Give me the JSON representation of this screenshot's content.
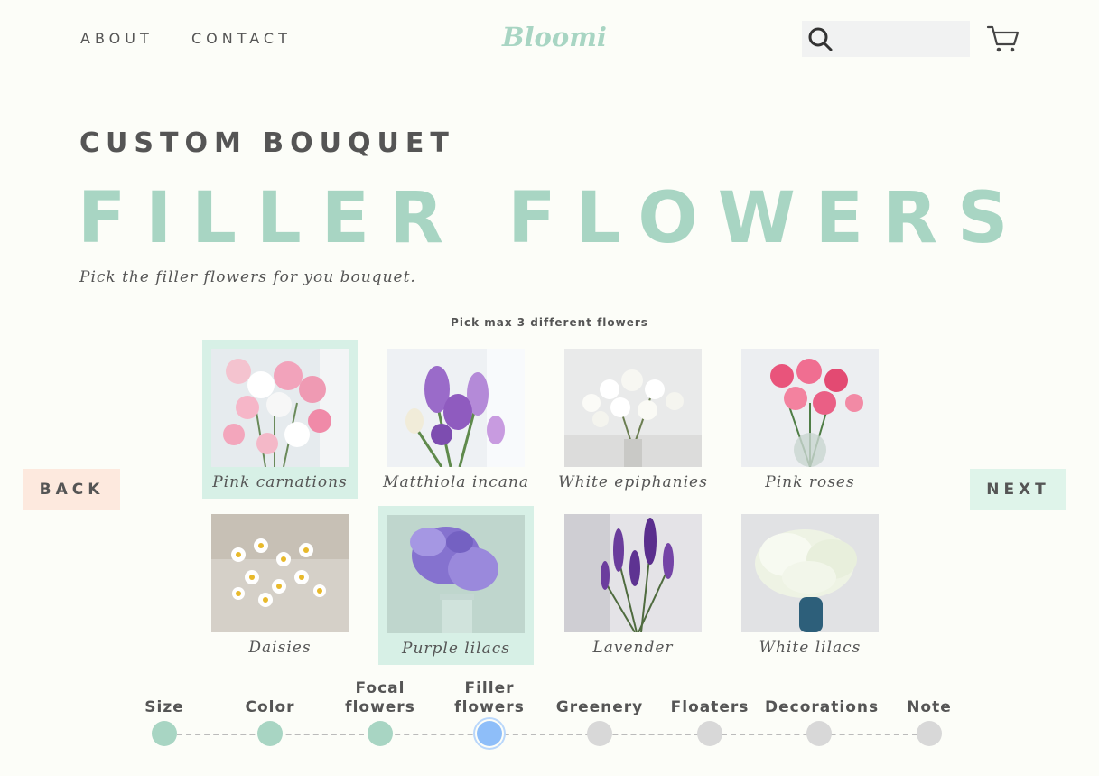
{
  "header": {
    "nav": [
      "ABOUT",
      "CONTACT"
    ],
    "logo": "Bloomi",
    "search_placeholder": ""
  },
  "page": {
    "subtitle": "CUSTOM BOUQUET",
    "title": "FILLER FLOWERS",
    "intro": "Pick the filler flowers for you bouquet.",
    "hint": "Pick max 3 different flowers"
  },
  "flowers": [
    {
      "name": "Pink carnations",
      "selected": true
    },
    {
      "name": "Matthiola incana",
      "selected": false
    },
    {
      "name": "White epiphanies",
      "selected": false
    },
    {
      "name": "Pink roses",
      "selected": false
    },
    {
      "name": "Daisies",
      "selected": false
    },
    {
      "name": "Purple lilacs",
      "selected": true
    },
    {
      "name": "Lavender",
      "selected": false
    },
    {
      "name": "White lilacs",
      "selected": false
    }
  ],
  "buttons": {
    "back": "BACK",
    "next": "NEXT"
  },
  "steps": [
    {
      "label": "Size",
      "state": "done"
    },
    {
      "label": "Color",
      "state": "done"
    },
    {
      "label": "Focal flowers",
      "state": "done"
    },
    {
      "label": "Filler flowers",
      "state": "current"
    },
    {
      "label": "Greenery",
      "state": "todo"
    },
    {
      "label": "Floaters",
      "state": "todo"
    },
    {
      "label": "Decorations",
      "state": "todo"
    },
    {
      "label": "Note",
      "state": "todo"
    }
  ],
  "colors": {
    "accent": "#a8d5c3",
    "selected_bg": "#d7f0e6",
    "back_bg": "#fde9de",
    "next_bg": "#dff4ea",
    "current_step": "#8ebef9",
    "pending_step": "#d8d8d8"
  }
}
